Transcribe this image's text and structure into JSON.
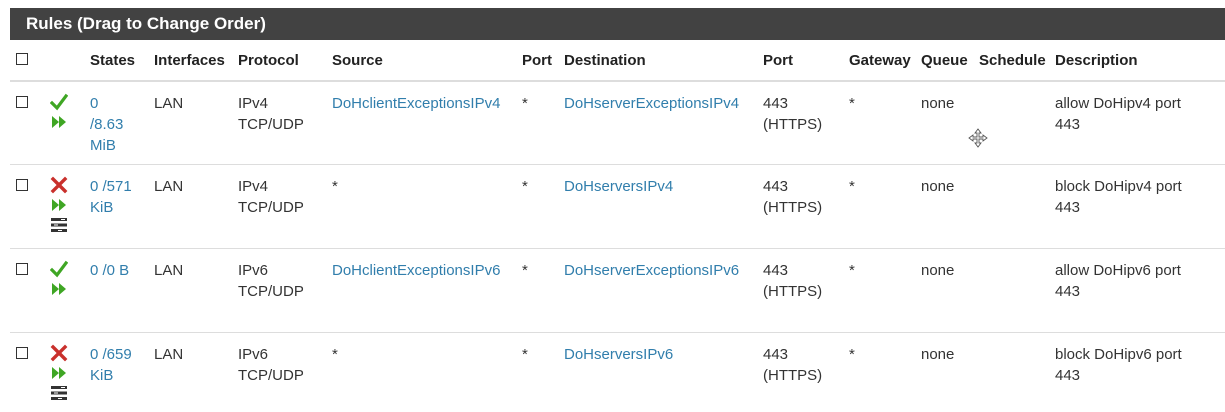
{
  "panel": {
    "title": "Rules (Drag to Change Order)"
  },
  "columns": {
    "states": "States",
    "interfaces": "Interfaces",
    "protocol": "Protocol",
    "source": "Source",
    "port": "Port",
    "destination": "Destination",
    "dest_port": "Port",
    "gateway": "Gateway",
    "queue": "Queue",
    "schedule": "Schedule",
    "description": "Description"
  },
  "rules": [
    {
      "action": "pass",
      "states_a": "0",
      "states_b": "/8.63",
      "states_c": "MiB",
      "interface": "LAN",
      "proto_a": "IPv4",
      "proto_b": "TCP/UDP",
      "source": "DoHclientExceptionsIPv4",
      "src_port": "*",
      "destination": "DoHserverExceptionsIPv4",
      "dst_port_a": "443",
      "dst_port_b": "(HTTPS)",
      "gateway": "*",
      "queue": "none",
      "schedule": "",
      "desc_a": "allow DoHipv4 port",
      "desc_b": "443"
    },
    {
      "action": "block",
      "states_a": "0 /571",
      "states_b": "KiB",
      "states_c": "",
      "interface": "LAN",
      "proto_a": "IPv4",
      "proto_b": "TCP/UDP",
      "source": "*",
      "src_port": "*",
      "destination": "DoHserversIPv4",
      "dst_port_a": "443",
      "dst_port_b": "(HTTPS)",
      "gateway": "*",
      "queue": "none",
      "schedule": "",
      "desc_a": "block DoHipv4 port",
      "desc_b": "443"
    },
    {
      "action": "pass",
      "states_a": "0 /0 B",
      "states_b": "",
      "states_c": "",
      "interface": "LAN",
      "proto_a": "IPv6",
      "proto_b": "TCP/UDP",
      "source": "DoHclientExceptionsIPv6",
      "src_port": "*",
      "destination": "DoHserverExceptionsIPv6",
      "dst_port_a": "443",
      "dst_port_b": "(HTTPS)",
      "gateway": "*",
      "queue": "none",
      "schedule": "",
      "desc_a": "allow DoHipv6 port",
      "desc_b": "443"
    },
    {
      "action": "block",
      "states_a": "0 /659",
      "states_b": "KiB",
      "states_c": "",
      "interface": "LAN",
      "proto_a": "IPv6",
      "proto_b": "TCP/UDP",
      "source": "*",
      "src_port": "*",
      "destination": "DoHserversIPv6",
      "dst_port_a": "443",
      "dst_port_b": "(HTTPS)",
      "gateway": "*",
      "queue": "none",
      "schedule": "",
      "desc_a": "block DoHipv6 port",
      "desc_b": "443"
    }
  ],
  "colors": {
    "pass": "#3fa624",
    "block": "#c9302c",
    "link": "#317eac",
    "header": "#424242"
  },
  "icons": {
    "pass": "check-icon",
    "block": "times-icon",
    "advanced": "fast-forward-icon",
    "log": "tasks-icon"
  }
}
